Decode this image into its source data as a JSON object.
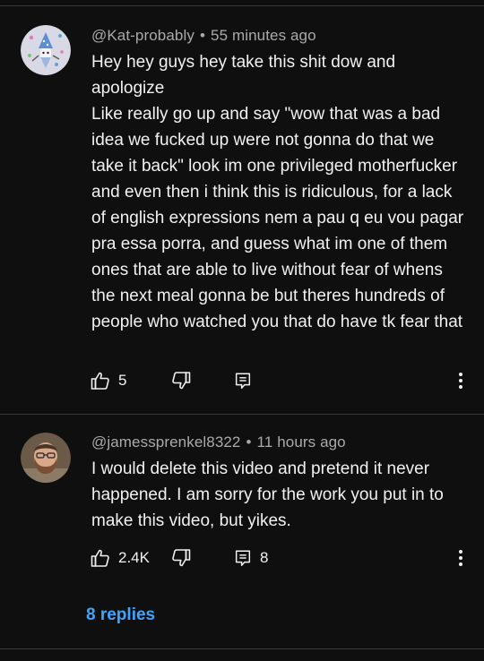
{
  "comments": [
    {
      "author": "@Kat-probably",
      "separator": "•",
      "time": "55 minutes ago",
      "paragraphs": [
        "Hey hey guys hey take this shit dow  and apologize",
        "Like really go up and say \"wow that was a bad idea we fucked up were not gonna do that we take it back\" look im one privileged motherfucker and even then i think this is ridiculous, for a lack of english expressions nem a pau q eu vou pagar pra essa porra, and guess what im one of them ones that are able to live without fear of whens the next meal gonna be but theres hundreds of people who watched you that do have tk fear that"
      ],
      "like_count": "5",
      "reply_count": "",
      "avatar_icon": "wizard-doodle-avatar"
    },
    {
      "author": "@jamessprenkel8322",
      "separator": "•",
      "time": "11 hours ago",
      "paragraphs": [
        "I would delete this video and pretend it never happened. I am sorry for the work you put in to make this video, but yikes."
      ],
      "like_count": "2.4K",
      "reply_count": "8",
      "replies_link": "8 replies",
      "avatar_icon": "bearded-man-avatar"
    }
  ],
  "icons": {
    "like": "thumbs-up-icon",
    "dislike": "thumbs-down-icon",
    "reply": "reply-icon",
    "more": "more-vertical-icon"
  },
  "colors": {
    "background": "#0f0f0f",
    "text": "#f1f1f1",
    "meta": "#aaaaaa",
    "link": "#3ea6ff",
    "divider": "#3a3a3a"
  }
}
